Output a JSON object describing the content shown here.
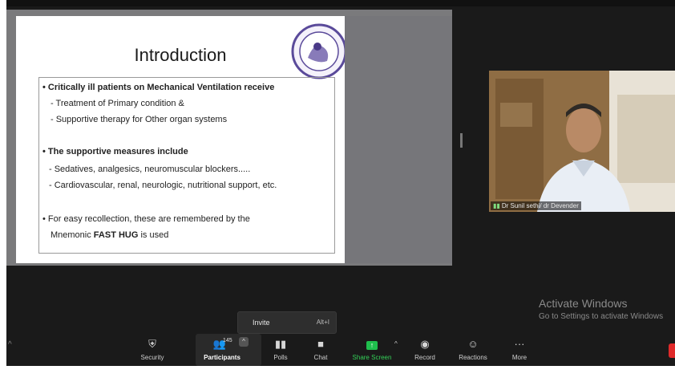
{
  "slide": {
    "title": "Introduction",
    "bullet1": "• Critically  ill patients on Mechanical Ventilation receive",
    "sub1": "- Treatment of Primary condition &",
    "sub2": "- Supportive therapy for Other organ systems",
    "bullet2": "• The supportive measures include",
    "sub3": "- Sedatives, analgesics, neuromuscular blockers.....",
    "sub4": "- Cardiovascular, renal, neurologic, nutritional support,  etc.",
    "bullet3": "•  For easy recollection, these are remembered by the",
    "bullet3_cont_prefix": "Mnemonic ",
    "bullet3_bold": "FAST HUG",
    "bullet3_cont_suffix": " is used"
  },
  "video": {
    "participant_label": "Dr Sunil sethi/ dr Devender"
  },
  "watermark": {
    "line1": "Activate Windows",
    "line2": "Go to Settings to activate Windows"
  },
  "invite_menu": {
    "label": "Invite",
    "shortcut": "Alt+I"
  },
  "toolbar": {
    "security": "Security",
    "participants": "Participants",
    "participants_count": "145",
    "polls": "Polls",
    "chat": "Chat",
    "share_screen": "Share Screen",
    "record": "Record",
    "reactions": "Reactions",
    "more": "More"
  },
  "icons": [
    "shield-icon",
    "participants-icon",
    "polls-icon",
    "chat-icon",
    "share-screen-icon",
    "record-icon",
    "reactions-icon",
    "more-icon",
    "signal-icon",
    "caret-up-icon"
  ],
  "colors": {
    "toolbar_bg": "#1a1a1a",
    "share_green": "#1fbf4d",
    "end_red": "#e02a2a"
  }
}
